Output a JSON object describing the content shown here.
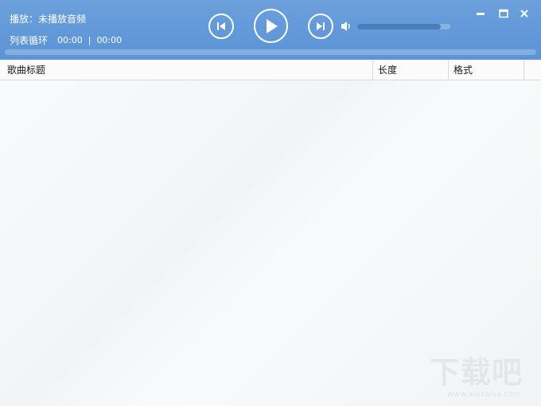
{
  "player": {
    "now_playing": "播放：未播放音频",
    "play_mode": "列表循环",
    "current_time": "00:00",
    "separator": "|",
    "total_time": "00:00",
    "volume_level": 0.9,
    "progress_level": 0
  },
  "controls": {
    "prev_icon": "skip-previous-icon",
    "play_icon": "play-icon",
    "next_icon": "skip-next-icon",
    "volume_icon": "speaker-icon"
  },
  "window": {
    "minimize_icon": "minimize-icon",
    "maximize_icon": "maximize-icon",
    "close_icon": "close-icon"
  },
  "columns": [
    "歌曲标题",
    "长度",
    "格式"
  ],
  "songs": [],
  "watermark": {
    "brand": "下载吧",
    "site": "www.xiazaiba.com"
  },
  "colors": {
    "header_bg": "#5e96d7",
    "progress_fill": "#4a7fb9",
    "list_bg": "#f5f6f8"
  }
}
